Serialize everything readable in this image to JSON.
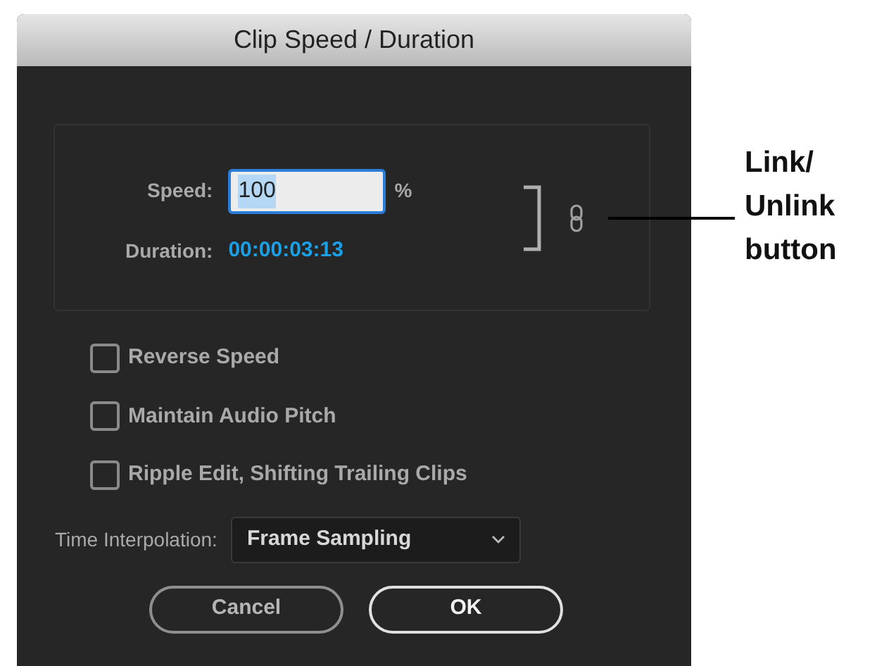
{
  "window": {
    "title": "Clip Speed / Duration"
  },
  "speed": {
    "label": "Speed:",
    "value": "100",
    "unit": "%"
  },
  "duration": {
    "label": "Duration:",
    "value": "00:00:03:13"
  },
  "options": [
    {
      "label": "Reverse Speed",
      "checked": false
    },
    {
      "label": "Maintain Audio Pitch",
      "checked": false
    },
    {
      "label": "Ripple Edit, Shifting Trailing Clips",
      "checked": false
    }
  ],
  "time_interpolation": {
    "label": "Time Interpolation:",
    "value": "Frame Sampling"
  },
  "buttons": [
    {
      "label": "Cancel",
      "kind": "secondary"
    },
    {
      "label": "OK",
      "kind": "default"
    }
  ],
  "annotation": {
    "text": "Link/ Unlink button"
  }
}
